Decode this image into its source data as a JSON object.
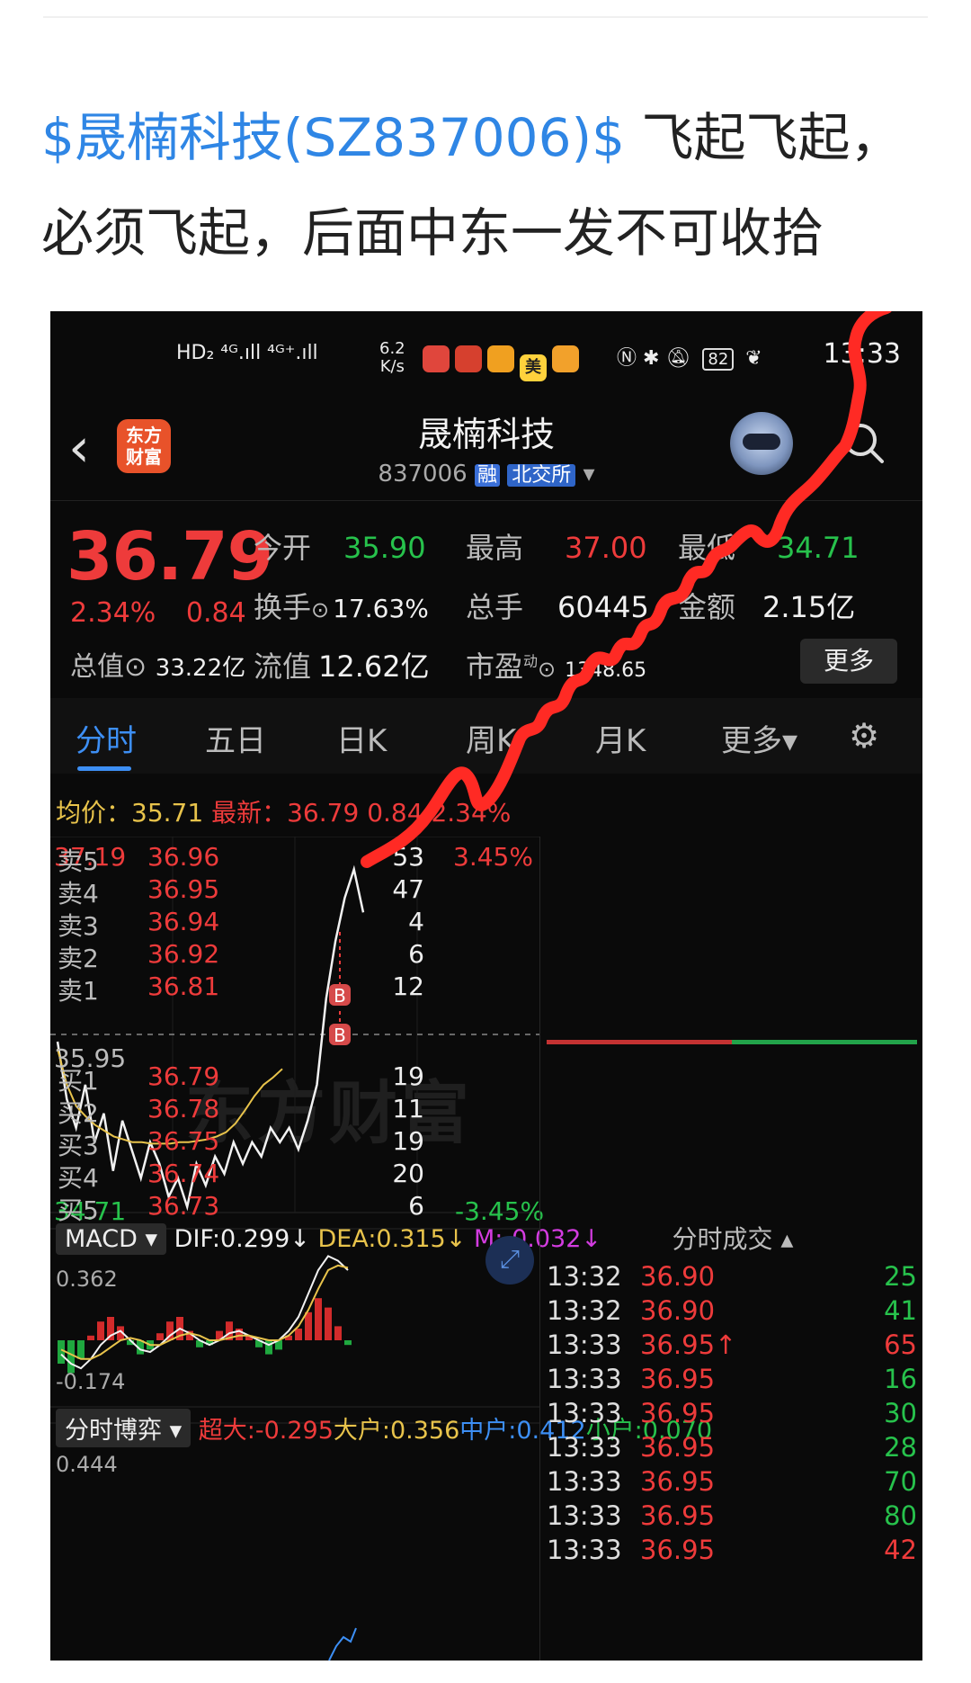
{
  "post": {
    "tag": "$晟楠科技(SZ837006)$",
    "text_line1": " 飞起飞起，",
    "text_line2": "必须飞起，后面中东一发不可收拾"
  },
  "status_bar": {
    "left": "HD₂ ⁴ᴳ.ıll ⁴ᴳ⁺.ıll",
    "speed_value": "6.2",
    "speed_unit": "K/s",
    "battery": "82",
    "time": "13:33",
    "app_icons": [
      "huawei-app-icon",
      "red-app-icon",
      "red-packet-icon",
      "meituan-icon",
      "wallet-icon"
    ],
    "right_icons": [
      "nfc-icon",
      "bluetooth-icon",
      "mute-icon",
      "battery-icon",
      "leaf-icon"
    ],
    "meituan_label": "美"
  },
  "header": {
    "logo_line1": "东方",
    "logo_line2": "财富",
    "title": "晟楠科技",
    "code": "837006",
    "badge_margin": "融",
    "badge_exchange": "北交所"
  },
  "quote": {
    "price": "36.79",
    "change_pct": "2.34%",
    "change_abs": "0.84",
    "open_label": "今开",
    "open_value": "35.90",
    "high_label": "最高",
    "high_value": "37.00",
    "low_label": "最低",
    "low_value": "34.71",
    "turnover_label": "换手",
    "turnover_value": "17.63%",
    "volume_label": "总手",
    "volume_value": "60445",
    "amount_label": "金额",
    "amount_value": "2.15亿",
    "total_cap_label": "总值",
    "total_cap_value": "33.22亿",
    "float_cap_label": "流值",
    "float_cap_value": "12.62亿",
    "pe_label": "市盈",
    "pe_sup": "动",
    "pe_value": "1348.65",
    "more_button": "更多"
  },
  "tabs": [
    {
      "label": "分时"
    },
    {
      "label": "五日"
    },
    {
      "label": "日K"
    },
    {
      "label": "周K"
    },
    {
      "label": "月K"
    },
    {
      "label": "更多▾"
    }
  ],
  "avg_line": {
    "avg_label": "均价：",
    "avg_value": "35.71",
    "latest_label": "最新：",
    "latest_value": "36.79",
    "latest_chg": "0.84",
    "latest_pct": "2.34%"
  },
  "chart_data": {
    "type": "line",
    "title": "",
    "ylim": [
      34.71,
      37.19
    ],
    "y_top_label": "37.19",
    "y_mid_label": "35.95",
    "y_bottom_label": "34.71",
    "pct_top_label": "3.45%",
    "pct_bottom_label": "-3.45%",
    "watermark": "东方财富",
    "markers": [
      "B",
      "B"
    ],
    "series": [
      {
        "values": [
          35.9,
          35.5,
          35.3,
          35.6,
          35.2,
          35.4,
          35.0,
          35.35,
          35.15,
          34.95,
          35.2,
          35.05,
          34.82,
          34.95,
          34.75,
          35.05,
          34.9,
          35.1,
          34.98,
          35.2,
          35.05,
          35.2,
          35.1,
          35.3,
          35.2,
          35.3,
          35.15,
          35.35,
          35.6,
          36.2,
          36.6,
          36.9,
          37.1,
          36.8
        ]
      },
      {
        "values": [
          35.85,
          35.6,
          35.45,
          35.38,
          35.32,
          35.28,
          35.24,
          35.22,
          35.2,
          35.2,
          35.19,
          35.19,
          35.19,
          35.2,
          35.2,
          35.21,
          35.22,
          35.24,
          35.27,
          35.33,
          35.42,
          35.52,
          35.6,
          35.65,
          35.71
        ]
      }
    ]
  },
  "macd": {
    "label": "MACD ▾",
    "dif": "DIF:0.299",
    "dif_arrow": "↓",
    "dea": "DEA:0.315",
    "dea_arrow": "↓",
    "m": "M:-0.032",
    "m_arrow": "↓",
    "top_value": "0.362",
    "bottom_value": "-0.174",
    "bars": [
      -0.1,
      -0.14,
      -0.08,
      0.02,
      0.08,
      0.1,
      0.06,
      -0.02,
      -0.06,
      -0.04,
      0.03,
      0.08,
      0.1,
      0.04,
      -0.03,
      -0.02,
      0.04,
      0.08,
      0.05,
      0.02,
      -0.03,
      -0.06,
      -0.04,
      0.02,
      0.05,
      0.12,
      0.18,
      0.14,
      0.06,
      -0.02
    ]
  },
  "flow": {
    "label": "分时博弈 ▾",
    "super": "超大:-0.295",
    "large": "大户:0.356",
    "mid": "中户:0.412",
    "small": "小户:0.070",
    "top_value": "0.444"
  },
  "order_book": {
    "asks": [
      {
        "name": "卖5",
        "price": "36.96",
        "vol": "53"
      },
      {
        "name": "卖4",
        "price": "36.95",
        "vol": "47"
      },
      {
        "name": "卖3",
        "price": "36.94",
        "vol": "4"
      },
      {
        "name": "卖2",
        "price": "36.92",
        "vol": "6"
      },
      {
        "name": "卖1",
        "price": "36.81",
        "vol": "12"
      }
    ],
    "bids": [
      {
        "name": "买1",
        "price": "36.79",
        "vol": "19"
      },
      {
        "name": "买2",
        "price": "36.78",
        "vol": "11"
      },
      {
        "name": "买3",
        "price": "36.75",
        "vol": "19"
      },
      {
        "name": "买4",
        "price": "36.74",
        "vol": "20"
      },
      {
        "name": "买5",
        "price": "36.73",
        "vol": "6"
      }
    ]
  },
  "trades": {
    "title": "分时成交 ▴",
    "rows": [
      {
        "time": "13:32",
        "price": "36.90",
        "vol": "25",
        "color": "#27c24c"
      },
      {
        "time": "13:32",
        "price": "36.90",
        "vol": "41",
        "color": "#27c24c"
      },
      {
        "time": "13:33",
        "price": "36.95↑",
        "vol": "65",
        "color": "#ee3b3b"
      },
      {
        "time": "13:33",
        "price": "36.95",
        "vol": "16",
        "color": "#27c24c"
      },
      {
        "time": "13:33",
        "price": "36.95",
        "vol": "30",
        "color": "#27c24c"
      },
      {
        "time": "13:33",
        "price": "36.95",
        "vol": "28",
        "color": "#27c24c"
      },
      {
        "time": "13:33",
        "price": "36.95",
        "vol": "70",
        "color": "#27c24c"
      },
      {
        "time": "13:33",
        "price": "36.95",
        "vol": "80",
        "color": "#27c24c"
      },
      {
        "time": "13:33",
        "price": "36.95",
        "vol": "42",
        "color": "#ee3b3b"
      }
    ]
  },
  "colors": {
    "up": "#ee3b3b",
    "down": "#27c24c",
    "accent": "#3d8ff5",
    "avg": "#e8c34b"
  }
}
